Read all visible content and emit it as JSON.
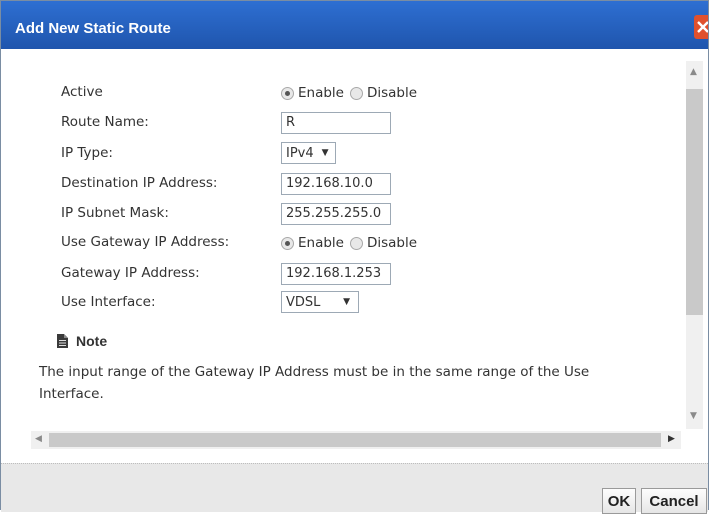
{
  "dialog": {
    "title": "Add New Static Route",
    "close_icon": "close-icon",
    "title_color": "#2563c6",
    "close_color": "#e0512e"
  },
  "form": {
    "active": {
      "label": "Active",
      "options": [
        "Enable",
        "Disable"
      ],
      "selected": "Enable"
    },
    "route_name": {
      "label": "Route Name:",
      "value": "R"
    },
    "ip_type": {
      "label": "IP Type:",
      "value": "IPv4"
    },
    "destination_ip": {
      "label": "Destination IP Address:",
      "value": "192.168.10.0"
    },
    "subnet_mask": {
      "label": "IP Subnet Mask:",
      "value": "255.255.255.0"
    },
    "use_gateway": {
      "label": "Use Gateway IP Address:",
      "options": [
        "Enable",
        "Disable"
      ],
      "selected": "Enable"
    },
    "gateway_ip": {
      "label": "Gateway IP Address:",
      "value": "192.168.1.253"
    },
    "use_interface": {
      "label": "Use Interface:",
      "value": "VDSL"
    }
  },
  "note": {
    "title": "Note",
    "icon": "document-icon",
    "text": "The input range of the Gateway IP Address must be in the same range of the Use Interface."
  },
  "footer": {
    "ok_label": "OK",
    "cancel_label": "Cancel"
  }
}
